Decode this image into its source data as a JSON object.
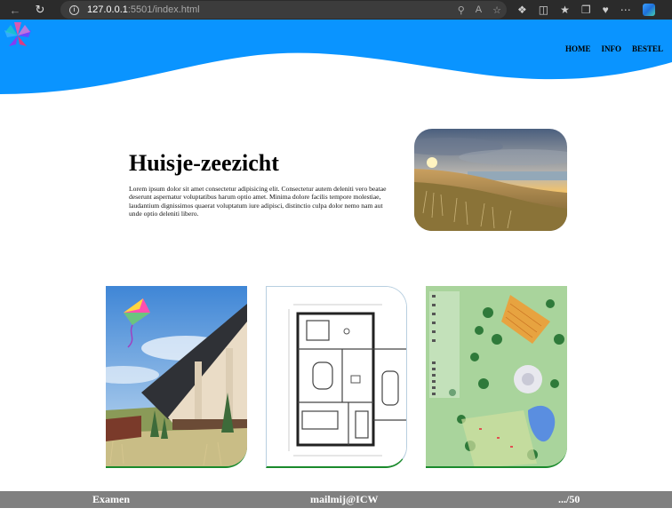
{
  "browser": {
    "url_host": "127.0.0.1",
    "url_rest": ":5501/index.html"
  },
  "nav": {
    "items": [
      "HOME",
      "INFO",
      "BESTEL"
    ]
  },
  "intro": {
    "title": "Huisje-zeezicht",
    "body": "Lorem ipsum dolor sit amet consectetur adipisicing elit. Consectetur autem deleniti vero beatae deserunt aspernatur voluptatibus harum optio amet. Minima dolore facilis tempore molestiae, laudantium dignissimos quaerat voluptatum iure adipisci, distinctio culpa dolor nemo nam aut unde optio deleniti libero."
  },
  "footer": {
    "left": "Examen",
    "center": "mailmij@ICW",
    "right": ".../50"
  },
  "colors": {
    "header_blue": "#0a94ff",
    "footer_gray": "#808080",
    "card_border_green": "#1a8a2c"
  }
}
